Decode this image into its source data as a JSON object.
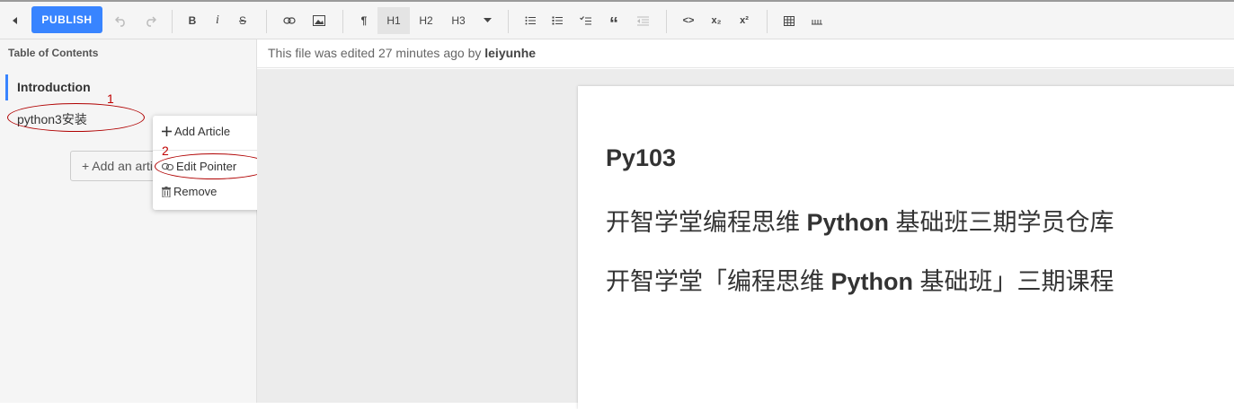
{
  "toolbar": {
    "publish_label": "PUBLISH",
    "paragraph_label": "¶",
    "h1_label": "H1",
    "h2_label": "H2",
    "h3_label": "H3",
    "bold_label": "B",
    "italic_label": "i",
    "strike_label": "S",
    "quote_label": "“",
    "code_label": "<>",
    "subscript_label": "x₂",
    "superscript_label": "x²"
  },
  "sidebar": {
    "title": "Table of Contents",
    "items": [
      {
        "label": "Introduction",
        "active": true
      },
      {
        "label": "python3安装",
        "active": false
      }
    ],
    "add_button_label": "+ Add an article"
  },
  "context_menu": {
    "items": [
      {
        "label": "Add Article",
        "icon": "plus-icon"
      },
      {
        "label": "Edit Pointer",
        "icon": "link-icon"
      },
      {
        "label": "Remove",
        "icon": "trash-icon"
      }
    ]
  },
  "annotations": {
    "marker_1": "1",
    "marker_2": "2",
    "color": "#c00000"
  },
  "status": {
    "prefix": "This file was edited 27 minutes ago by",
    "user": "leiyunhe"
  },
  "document": {
    "title": "Py103",
    "line1_a": "开智学堂编程思维 ",
    "line1_b": "Python",
    "line1_c": " 基础班三期学员仓库",
    "line2_a": "开智学堂「编程思维 ",
    "line2_b": "Python",
    "line2_c": " 基础班」三期课程"
  },
  "colors": {
    "accent": "#3884ff",
    "annotation": "#b00000"
  }
}
